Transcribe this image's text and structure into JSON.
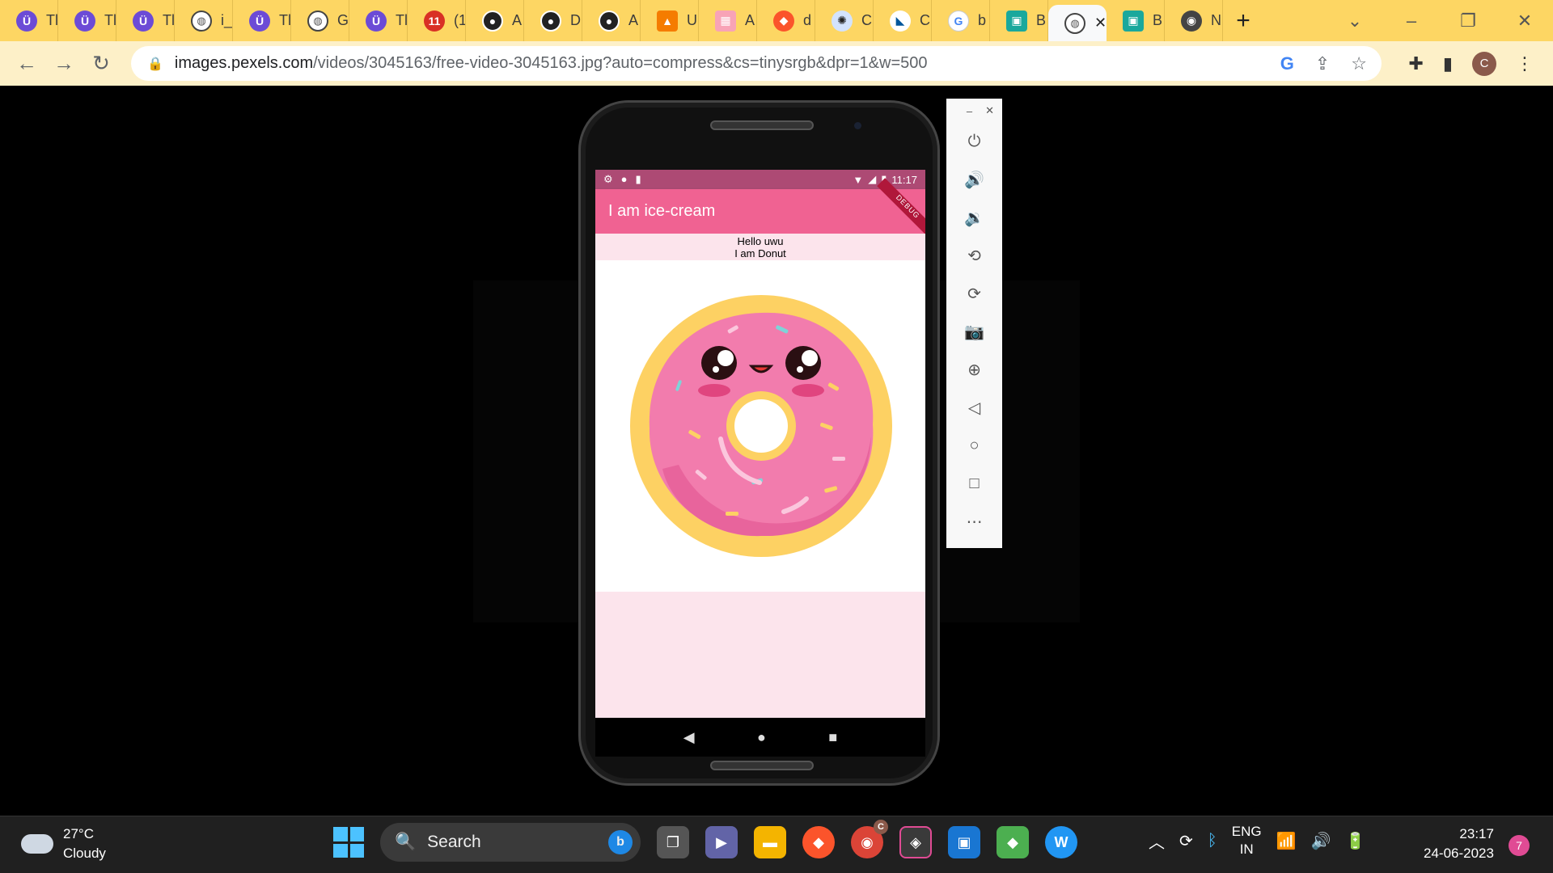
{
  "browser": {
    "tabs": [
      {
        "icon": "udemy-icon",
        "label": "Tl"
      },
      {
        "icon": "udemy-icon",
        "label": "Tl"
      },
      {
        "icon": "udemy-icon",
        "label": "Tl"
      },
      {
        "icon": "globe-icon",
        "label": "i_"
      },
      {
        "icon": "udemy-icon",
        "label": "Tl"
      },
      {
        "icon": "globe-icon",
        "label": "G"
      },
      {
        "icon": "udemy-icon",
        "label": "Tl"
      },
      {
        "icon": "notification-icon",
        "label": "(1",
        "badge": "11"
      },
      {
        "icon": "github-icon",
        "label": "A"
      },
      {
        "icon": "github-icon",
        "label": "D"
      },
      {
        "icon": "github-icon",
        "label": "A"
      },
      {
        "icon": "orange-app-icon",
        "label": "U"
      },
      {
        "icon": "apps-icon",
        "label": "A"
      },
      {
        "icon": "brave-icon",
        "label": "d"
      },
      {
        "icon": "openai-icon",
        "label": "C"
      },
      {
        "icon": "flutter-icon",
        "label": "C"
      },
      {
        "icon": "google-icon",
        "label": "b"
      },
      {
        "icon": "capacitor-icon",
        "label": "B"
      },
      {
        "icon": "globe-icon",
        "label": "",
        "active": true,
        "close": "✕"
      },
      {
        "icon": "capacitor-icon",
        "label": "B"
      },
      {
        "icon": "chrome-icon",
        "label": "N"
      }
    ],
    "new_tab": "+",
    "url_host": "images.pexels.com",
    "url_path": "/videos/3045163/free-video-3045163.jpg?auto=compress&cs=tinysrgb&dpr=1&w=500",
    "avatar_letter": "C"
  },
  "phone": {
    "status_time": "11:17",
    "app_title": "I am ice-cream",
    "debug_banner": "DEBUG",
    "greeting_line1": "Hello uwu",
    "greeting_line2": "I am Donut"
  },
  "taskbar": {
    "temperature": "27°C",
    "weather": "Cloudy",
    "search_placeholder": "Search",
    "lang_top": "ENG",
    "lang_bottom": "IN",
    "time": "23:17",
    "date": "24-06-2023",
    "notification_count": "7",
    "chrome_badge": "C"
  },
  "colors": {
    "tab_strip": "#fdd663",
    "app_bar": "#f06292",
    "status_bar": "#ad4a74",
    "pink_bg": "#fce4ec",
    "donut_dough": "#fdd163",
    "donut_icing": "#f27cad"
  }
}
